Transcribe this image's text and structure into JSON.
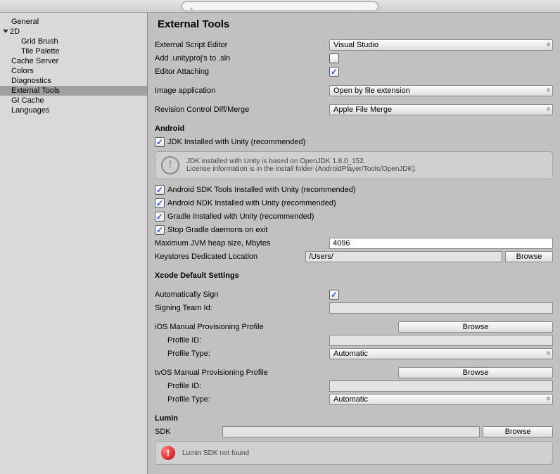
{
  "sidebar": {
    "items": [
      {
        "label": "General"
      },
      {
        "label": "2D",
        "expanded": true,
        "children": [
          {
            "label": "Grid Brush"
          },
          {
            "label": "Tile Palette"
          }
        ]
      },
      {
        "label": "Cache Server"
      },
      {
        "label": "Colors"
      },
      {
        "label": "Diagnostics"
      },
      {
        "label": "External Tools",
        "selected": true
      },
      {
        "label": "GI Cache"
      },
      {
        "label": "Languages"
      }
    ]
  },
  "page": {
    "title": "External Tools",
    "scriptEditorLabel": "External Script Editor",
    "scriptEditorValue": "Visual Studio",
    "addUnityProjLabel": "Add .unityproj's to .sln",
    "addUnityProjChecked": false,
    "editorAttachingLabel": "Editor Attaching",
    "editorAttachingChecked": true,
    "imageAppLabel": "Image application",
    "imageAppValue": "Open by file extension",
    "revControlLabel": "Revision Control Diff/Merge",
    "revControlValue": "Apple File Merge"
  },
  "android": {
    "header": "Android",
    "jdkLabel": "JDK Installed with Unity (recommended)",
    "jdkInfoLine1": "JDK installed with Unity is based on OpenJDK 1.8.0_152.",
    "jdkInfoLine2": "License information is in the install folder (AndroidPlayer/Tools/OpenJDK).",
    "sdkLabel": "Android SDK Tools Installed with Unity (recommended)",
    "ndkLabel": "Android NDK Installed with Unity (recommended)",
    "gradleLabel": "Gradle Installed with Unity (recommended)",
    "stopGradleLabel": "Stop Gradle daemons on exit",
    "heapLabel": "Maximum JVM heap size, Mbytes",
    "heapValue": "4096",
    "keystoreLabel": "Keystores Dedicated Location",
    "keystoreValue": "/Users/",
    "browseLabel": "Browse"
  },
  "xcode": {
    "header": "Xcode Default Settings",
    "autoSignLabel": "Automatically Sign",
    "autoSignChecked": true,
    "teamIdLabel": "Signing Team Id:",
    "iosHeader": "iOS Manual Provisioning Profile",
    "profileIdLabel": "Profile ID:",
    "profileTypeLabel": "Profile Type:",
    "profileTypeValue": "Automatic",
    "tvosHeader": "tvOS Manual Provisioning Profile",
    "browseLabel": "Browse"
  },
  "lumin": {
    "header": "Lumin",
    "sdkLabel": "SDK",
    "browseLabel": "Browse",
    "errorMsg": "Lumin SDK not found"
  }
}
